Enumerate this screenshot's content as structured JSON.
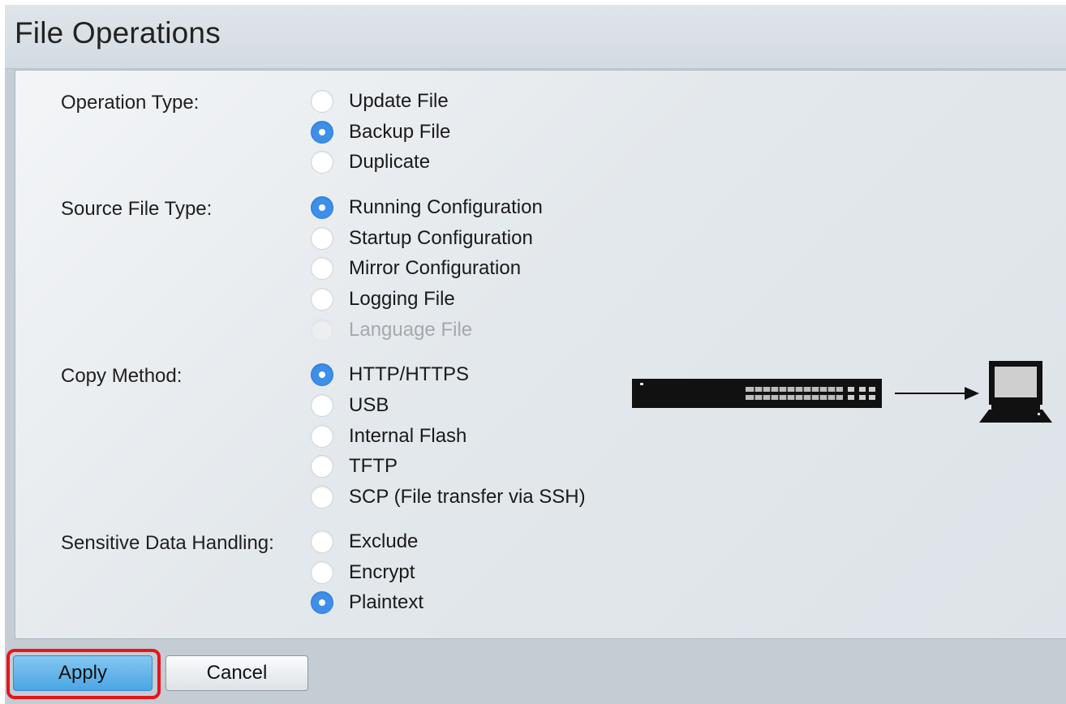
{
  "page": {
    "title": "File Operations"
  },
  "form": {
    "operation_type": {
      "label": "Operation Type:",
      "options": [
        {
          "label": "Update File",
          "checked": false,
          "disabled": false
        },
        {
          "label": "Backup File",
          "checked": true,
          "disabled": false
        },
        {
          "label": "Duplicate",
          "checked": false,
          "disabled": false
        }
      ]
    },
    "source_file_type": {
      "label": "Source File Type:",
      "options": [
        {
          "label": "Running Configuration",
          "checked": true,
          "disabled": false
        },
        {
          "label": "Startup Configuration",
          "checked": false,
          "disabled": false
        },
        {
          "label": "Mirror Configuration",
          "checked": false,
          "disabled": false
        },
        {
          "label": "Logging File",
          "checked": false,
          "disabled": false
        },
        {
          "label": "Language File",
          "checked": false,
          "disabled": true
        }
      ]
    },
    "copy_method": {
      "label": "Copy Method:",
      "options": [
        {
          "label": "HTTP/HTTPS",
          "checked": true,
          "disabled": false
        },
        {
          "label": "USB",
          "checked": false,
          "disabled": false
        },
        {
          "label": "Internal Flash",
          "checked": false,
          "disabled": false
        },
        {
          "label": "TFTP",
          "checked": false,
          "disabled": false
        },
        {
          "label": "SCP (File transfer via SSH)",
          "checked": false,
          "disabled": false
        }
      ]
    },
    "sensitive_data_handling": {
      "label": "Sensitive Data Handling:",
      "options": [
        {
          "label": "Exclude",
          "checked": false,
          "disabled": false
        },
        {
          "label": "Encrypt",
          "checked": false,
          "disabled": false
        },
        {
          "label": "Plaintext",
          "checked": true,
          "disabled": false
        }
      ]
    }
  },
  "diagram": {
    "icons": [
      "network-switch-icon",
      "arrow-right-icon",
      "laptop-icon"
    ]
  },
  "footer": {
    "apply_label": "Apply",
    "cancel_label": "Cancel"
  },
  "colors": {
    "accent": "#3d8fea",
    "highlight": "#e8141b",
    "header_bg": "#dbe2e8"
  }
}
